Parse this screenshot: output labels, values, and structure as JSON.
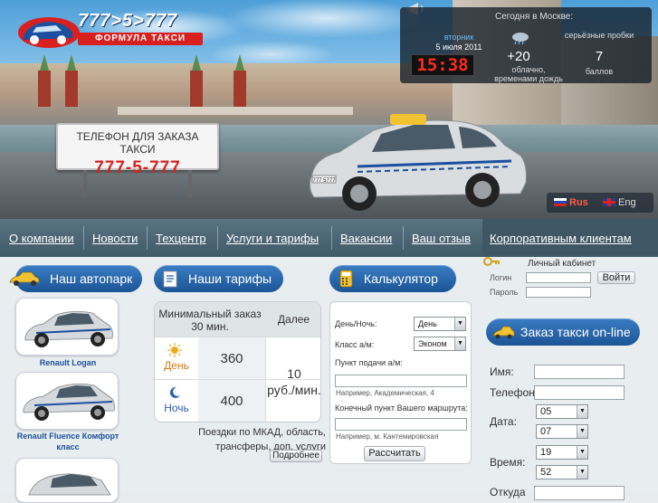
{
  "header": {
    "logo_number": "777>5>777",
    "logo_name": "ФОРМУЛА ТАКСИ",
    "phone_sign_title": "ТЕЛЕФОН ДЛЯ ЗАКАЗА ТАКСИ",
    "phone_sign_number": "777-5-777",
    "taxi_plate": "777 5777"
  },
  "weather": {
    "title": "Сегодня в Москве:",
    "weekday": "вторник",
    "date": "5 июля 2011",
    "time": "15:38",
    "temperature": "+20",
    "condition": "облачно, временами дождь",
    "traffic_label": "серьёзные пробки",
    "traffic_value": "7",
    "traffic_unit": "баллов"
  },
  "language": {
    "ru": "Rus",
    "en": "Eng"
  },
  "nav": {
    "about": "О компании",
    "news": "Новости",
    "techcenter": "Техцентр",
    "services": "Услуги и тарифы",
    "vacancies": "Вакансии",
    "feedback": "Ваш отзыв",
    "corporate": "Корпоративным клиентам"
  },
  "sections": {
    "fleet": "Наш автопарк",
    "tariffs": "Наши тарифы",
    "calculator": "Калькулятор",
    "order": "Заказ такси on-line"
  },
  "fleet": {
    "cars": [
      {
        "caption": "Renault Logan"
      },
      {
        "caption": "Renault Fluence Комфорт класс"
      },
      {
        "caption": ""
      }
    ]
  },
  "tariffs": {
    "min_order_header": "Минимальный заказ 30 мин.",
    "further_header": "Далее",
    "day_label": "День",
    "night_label": "Ночь",
    "day_price": "360",
    "night_price": "400",
    "further_price": "10",
    "further_unit": "руб./мин.",
    "note": "Поездки по МКАД, область, трансферы, доп. услуги",
    "more_button": "Подробнее"
  },
  "calculator": {
    "day_night_label": "День/Ночь:",
    "day_night_value": "День",
    "class_label": "Класс а/м:",
    "class_value": "Эконом",
    "pickup_label": "Пункт подачи а/м:",
    "pickup_hint": "Например, Академическая, 4",
    "destination_label": "Конечный пункт Вашего маршрута:",
    "destination_hint": "Например, м. Кантемировская",
    "submit": "Рассчитать"
  },
  "cabinet": {
    "title": "Личный кабинет",
    "login_label": "Логин",
    "password_label": "Пароль",
    "submit": "Войти"
  },
  "order": {
    "name_label": "Имя:",
    "phone_label": "Телефон:",
    "date_label": "Дата:",
    "date_day": "05",
    "date_month": "07",
    "time_label": "Время:",
    "time_hour": "19",
    "time_minute": "52",
    "from_label": "Откуда"
  }
}
